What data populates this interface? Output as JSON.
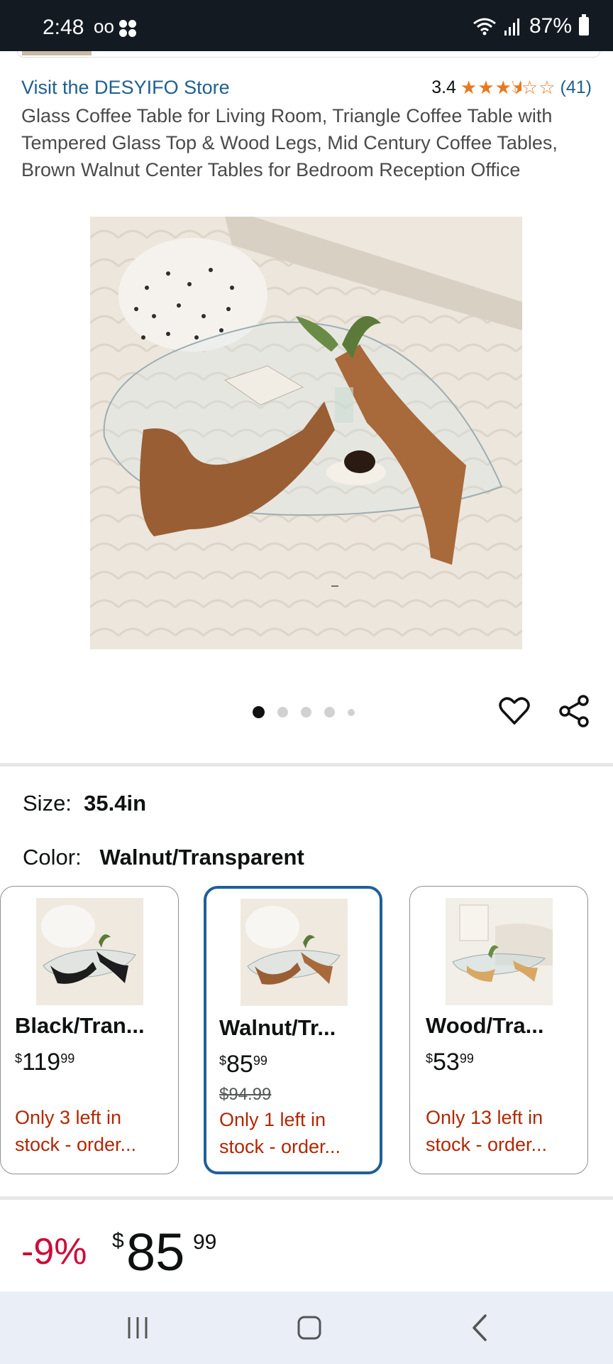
{
  "status_bar": {
    "time": "2:48",
    "voicemail": "oo",
    "battery": "87%"
  },
  "store_link": "Visit the DESYIFO Store",
  "rating": {
    "value": "3.4",
    "stars_full": "★★★",
    "stars_half": "★",
    "stars_empty": "☆☆",
    "count": "(41)",
    "star_color": "#e9771e"
  },
  "title": "Glass Coffee Table for Living Room, Triangle Coffee Table with Tempered Glass Top & Wood Legs, Mid Century Coffee Tables, Brown Walnut Center Tables for Bedroom Reception Office",
  "gallery": {
    "image_count": 5,
    "active_index": 0
  },
  "size": {
    "label": "Size:",
    "value": "35.4in"
  },
  "color": {
    "label": "Color:",
    "value": "Walnut/Transparent"
  },
  "variants": [
    {
      "name": "Black/Tran...",
      "price_symbol": "$",
      "price_whole": "119",
      "price_fraction": "99",
      "old_price": "",
      "stock_line1": "Only 3 left in",
      "stock_line2": "stock - order...",
      "selected": false
    },
    {
      "name": "Walnut/Tr...",
      "price_symbol": "$",
      "price_whole": "85",
      "price_fraction": "99",
      "old_price": "$94.99",
      "stock_line1": "Only 1 left in",
      "stock_line2": "stock - order...",
      "selected": true
    },
    {
      "name": "Wood/Tra...",
      "price_symbol": "$",
      "price_whole": "53",
      "price_fraction": "99",
      "old_price": "",
      "stock_line1": "Only 13 left in",
      "stock_line2": "stock - order...",
      "selected": false
    }
  ],
  "price": {
    "discount": "-9%",
    "symbol": "$",
    "whole": "85",
    "fraction": "99"
  },
  "colors": {
    "link": "#1f5f8f",
    "deal_red": "#cc0c39",
    "stock_red": "#b12704",
    "selected_border": "#1f5f98"
  }
}
